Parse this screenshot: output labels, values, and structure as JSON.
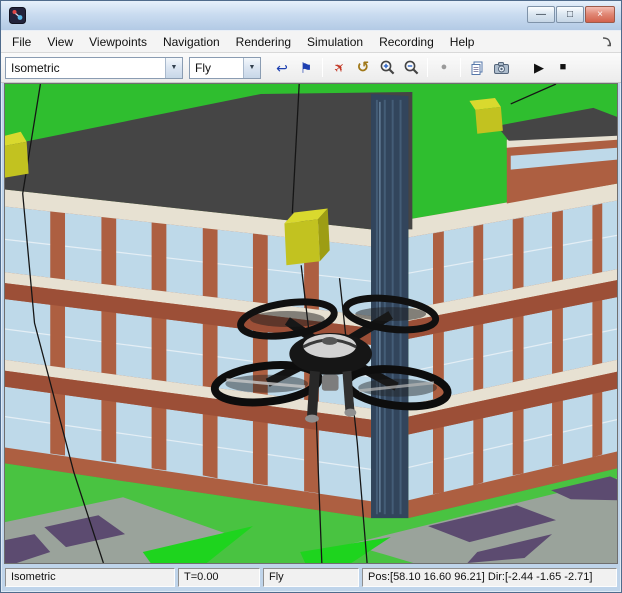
{
  "window": {
    "title": "",
    "controls": {
      "minimize": "—",
      "maximize": "□",
      "close": "×"
    }
  },
  "menu_bar": {
    "items": [
      "File",
      "View",
      "Viewpoints",
      "Navigation",
      "Rendering",
      "Simulation",
      "Recording",
      "Help"
    ]
  },
  "toolbar": {
    "viewpoint_value": "Isometric",
    "navigation_value": "Fly",
    "dropdown_arrow": "▼",
    "reset_viewpoint_glyph": "↩",
    "create_viewpoint_glyph": "⚑",
    "straighten_up_glyph": "✈",
    "undo_move_glyph": "↺",
    "record_glyph": "●",
    "play_glyph": "▶",
    "stop_glyph": "■"
  },
  "viewport": {
    "scene": {
      "colors": {
        "grass": "#2fbe2f",
        "grass_light": "#49c341",
        "grass_bright": "#1ed41e",
        "pavement": "#9aa39b",
        "marking": "#5c4b70",
        "roof": "#454545",
        "brick": "#ad5f41",
        "brick_dark": "#9c4f37",
        "trim": "#e7e1d2",
        "glass": "#bed9e9",
        "glass_dark": "#32455c",
        "waypoint": "#c2c220",
        "waypoint_top": "#d9d92e",
        "waypoint_side": "#9d9d14",
        "drone_body": "#161616",
        "drone_canopy": "#d2d2d2"
      }
    }
  },
  "status_bar": {
    "viewpoint": "Isometric",
    "time": "T=0.00",
    "navigation": "Fly",
    "pose": "Pos:[58.10 16.60 96.21] Dir:[-2.44 -1.65 -2.71]"
  }
}
